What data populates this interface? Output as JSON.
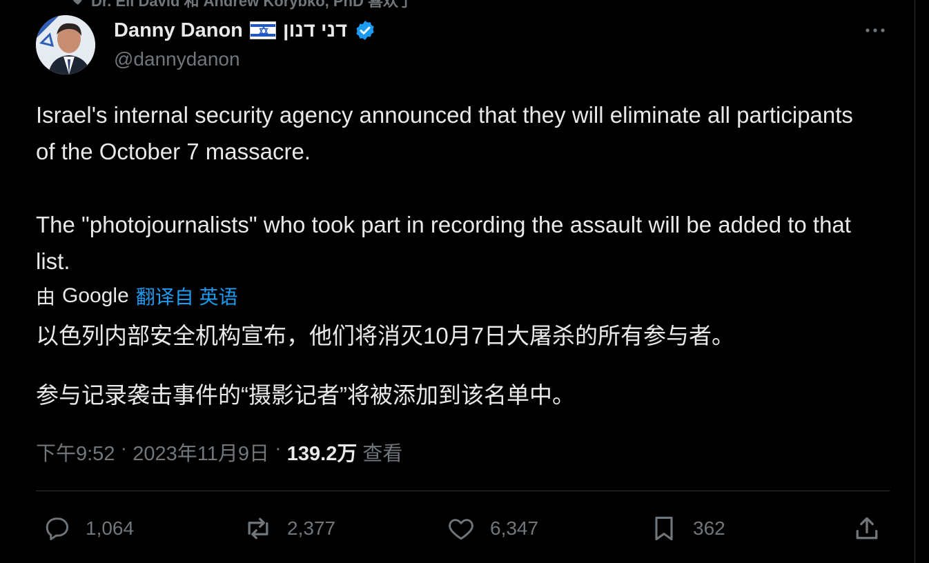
{
  "liked_by": {
    "text": "Dr. Eli David 和 Andrew Korybko, PhD 喜欢了"
  },
  "author": {
    "name": "Danny Danon",
    "hebrew_name": "דני דנון",
    "handle": "@dannydanon",
    "avatar_icon": "profile-photo",
    "verified_icon": "verified-badge-icon",
    "flag_icon": "israel-flag-icon"
  },
  "tweet": {
    "para1": "Israel's internal security agency announced that they will eliminate all participants of the October 7 massacre.",
    "para2": "The \"photojournalists\" who took part in recording the assault will be added to that list."
  },
  "translation": {
    "prefix": "由",
    "provider": "Google",
    "link": "翻译自 英语",
    "para1": "以色列内部安全机构宣布，他们将消灭10月7日大屠杀的所有参与者。",
    "para2": "参与记录袭击事件的“摄影记者”将被添加到该名单中。"
  },
  "meta": {
    "time": "下午9:52",
    "sep1": " · ",
    "date": "2023年11月9日",
    "sep2": " · ",
    "views_count": "139.2万",
    "views_label": " 查看"
  },
  "actions": {
    "replies": "1,064",
    "reposts": "2,377",
    "likes": "6,347",
    "bookmarks": "362"
  },
  "colors": {
    "background": "#000000",
    "text": "#e7e9ea",
    "muted": "#71767b",
    "accent": "#1d9bf0",
    "divider": "#2f3336"
  }
}
